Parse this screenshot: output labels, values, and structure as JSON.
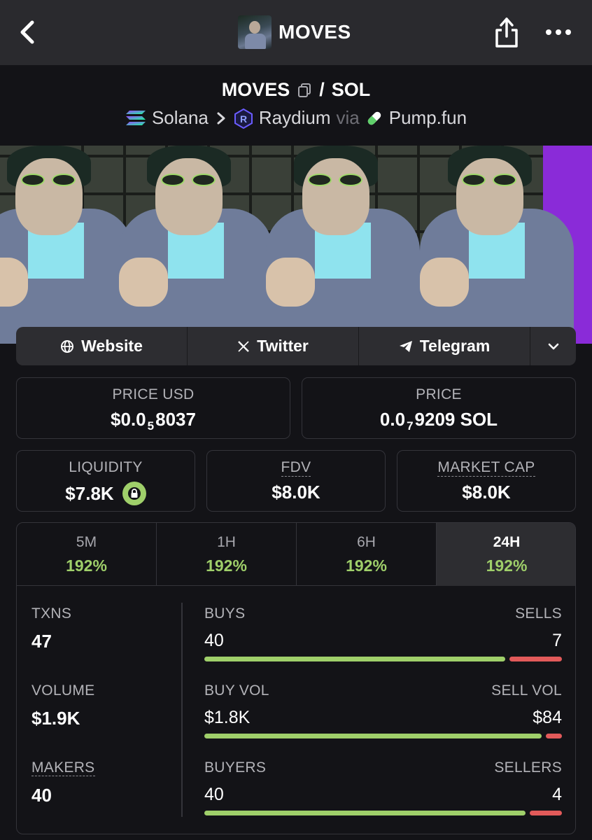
{
  "header": {
    "title": "MOVES",
    "back_icon": "chevron-left-icon",
    "share_icon": "share-icon",
    "more_icon": "more-horizontal-icon"
  },
  "pair": {
    "token": "MOVES",
    "separator": "/",
    "quote": "SOL",
    "chain": "Solana",
    "dex": "Raydium",
    "via_label": "via",
    "launchpad": "Pump.fun"
  },
  "links": {
    "website": "Website",
    "twitter": "Twitter",
    "telegram": "Telegram"
  },
  "price_usd": {
    "label": "PRICE USD",
    "prefix": "$0.0",
    "zeros": "5",
    "digits": "8037"
  },
  "price_native": {
    "label": "PRICE",
    "prefix": "0.0",
    "zeros": "7",
    "digits": "9209 SOL"
  },
  "liquidity": {
    "label": "LIQUIDITY",
    "value": "$7.8K"
  },
  "fdv": {
    "label": "FDV",
    "value": "$8.0K"
  },
  "market_cap": {
    "label": "MARKET CAP",
    "value": "$8.0K"
  },
  "timeframes": [
    {
      "label": "5M",
      "change": "192%"
    },
    {
      "label": "1H",
      "change": "192%"
    },
    {
      "label": "6H",
      "change": "192%"
    },
    {
      "label": "24H",
      "change": "192%",
      "active": true
    }
  ],
  "stats": {
    "txns": {
      "label": "TXNS",
      "value": "47"
    },
    "volume": {
      "label": "VOLUME",
      "value": "$1.9K"
    },
    "makers": {
      "label": "MAKERS",
      "value": "40"
    },
    "buys_sells": {
      "left_label": "BUYS",
      "right_label": "SELLS",
      "left_value": "40",
      "right_value": "7",
      "ratio": 0.851
    },
    "vol_split": {
      "left_label": "BUY VOL",
      "right_label": "SELL VOL",
      "left_value": "$1.8K",
      "right_value": "$84",
      "ratio": 0.955
    },
    "buyers_sellers": {
      "left_label": "BUYERS",
      "right_label": "SELLERS",
      "left_value": "40",
      "right_value": "4",
      "ratio": 0.909
    }
  },
  "colors": {
    "positive": "#9fcf6a",
    "negative": "#e25a5a",
    "background": "#131317",
    "panel": "#2d2d31"
  }
}
